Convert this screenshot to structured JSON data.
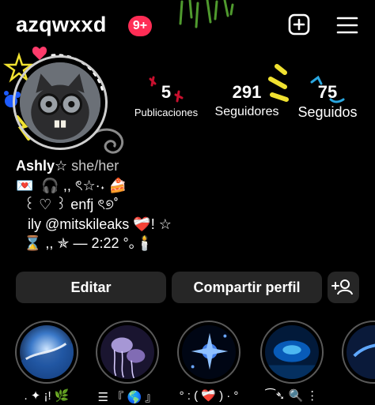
{
  "header": {
    "username": "azqwxxd",
    "notification_badge": "9+",
    "create_icon": "plus-square-icon",
    "menu_icon": "hamburger-menu-icon"
  },
  "stats": {
    "posts": {
      "value": "5",
      "label": "Publicaciones"
    },
    "followers": {
      "value": "291",
      "label": "Seguidores"
    },
    "following": {
      "value": "75",
      "label": "Seguidos"
    }
  },
  "bio": {
    "name": "Ashly☆",
    "pronouns": "she/her",
    "line1": "💌  🎧 ,, ৎ☆·˖ 🍰",
    "line2": "  ꒰ ♡ ꒱ enfj ৎ୭˚",
    "line3": "   ily @mitskileaks ❤️‍🩹! ☆",
    "line4": "  ⌛ ,, ✯ — 2:22 °｡🕯️"
  },
  "actions": {
    "edit_label": "Editar",
    "share_label": "Compartir perfil",
    "add_person_icon": "add-person-icon"
  },
  "highlights": [
    {
      "label": ". ✦ ¡! 🌿"
    },
    {
      "label": "☰ 『 🌎 』"
    },
    {
      "label": "° : ( ❤️‍🩹 ) · °"
    },
    {
      "label": "⁀➴ 🔍 ⋮"
    },
    {
      "label": ""
    }
  ],
  "colors": {
    "background": "#000000",
    "badge": "#ff2d55",
    "button": "#262626",
    "deco_green": "#6bbd3a",
    "deco_yellow": "#f0e130",
    "deco_blue": "#1e5cff"
  }
}
